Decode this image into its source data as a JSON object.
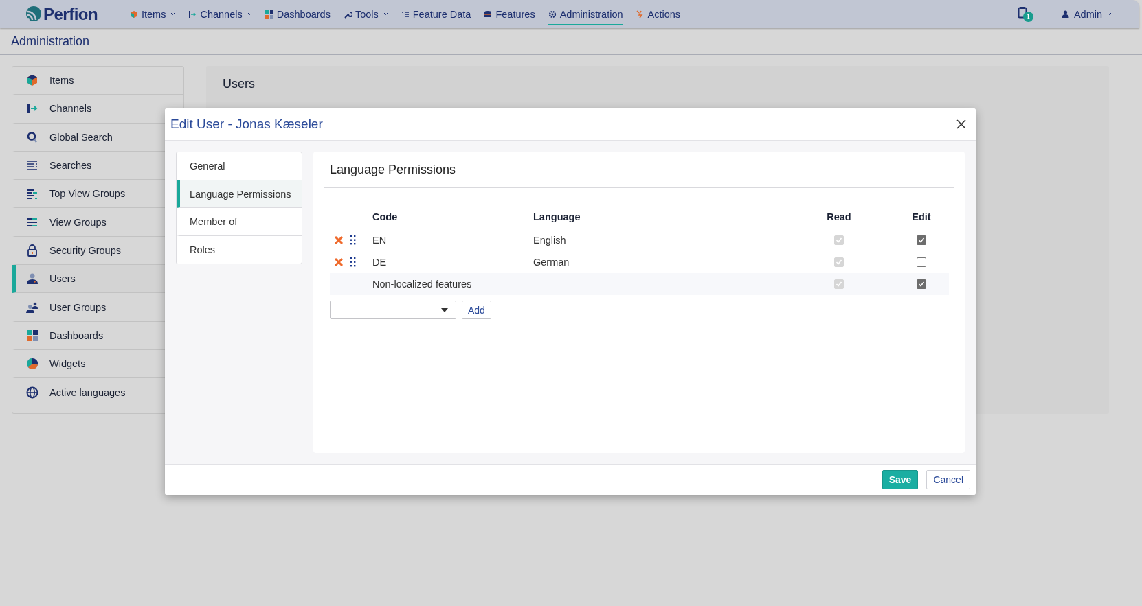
{
  "top_nav": {
    "logo": "Perfion",
    "items": [
      {
        "label": "Items",
        "has_menu": true,
        "selected": false
      },
      {
        "label": "Channels",
        "has_menu": true,
        "selected": false
      },
      {
        "label": "Dashboards",
        "has_menu": false,
        "selected": false
      },
      {
        "label": "Tools",
        "has_menu": true,
        "selected": false
      },
      {
        "label": "Feature Data",
        "has_menu": false,
        "selected": false
      },
      {
        "label": "Features",
        "has_menu": false,
        "selected": false
      },
      {
        "label": "Administration",
        "has_menu": false,
        "selected": true
      },
      {
        "label": "Actions",
        "has_menu": false,
        "selected": false
      }
    ],
    "notification_count": "1",
    "user": "Admin"
  },
  "page_title": "Administration",
  "sidebar": {
    "items": [
      {
        "label": "Items",
        "selected": false
      },
      {
        "label": "Channels",
        "selected": false
      },
      {
        "label": "Global Search",
        "selected": false
      },
      {
        "label": "Searches",
        "selected": false
      },
      {
        "label": "Top View Groups",
        "selected": false
      },
      {
        "label": "View Groups",
        "selected": false
      },
      {
        "label": "Security Groups",
        "selected": false
      },
      {
        "label": "Users",
        "selected": true
      },
      {
        "label": "User Groups",
        "selected": false
      },
      {
        "label": "Dashboards",
        "selected": false
      },
      {
        "label": "Widgets",
        "selected": false
      },
      {
        "label": "Active languages",
        "selected": false
      }
    ]
  },
  "panel": {
    "title": "Users"
  },
  "dialog": {
    "title": "Edit User - Jonas Kæseler",
    "tabs": [
      {
        "label": "General",
        "selected": false
      },
      {
        "label": "Language Permissions",
        "selected": true
      },
      {
        "label": "Member of",
        "selected": false
      },
      {
        "label": "Roles",
        "selected": false
      }
    ],
    "section_title": "Language Permissions",
    "columns": [
      "Code",
      "Language",
      "Read",
      "Edit"
    ],
    "rows": [
      {
        "kind": "language",
        "code": "EN",
        "language": "English",
        "read": true,
        "read_disabled": true,
        "edit": true
      },
      {
        "kind": "language",
        "code": "DE",
        "language": "German",
        "read": true,
        "read_disabled": true,
        "edit": false
      },
      {
        "kind": "nonlocalized",
        "code": "Non-localized features",
        "read": true,
        "read_disabled": true,
        "edit": true
      }
    ],
    "add_button": "Add",
    "buttons": [
      {
        "label": "Save",
        "kind": "primary"
      },
      {
        "label": "Cancel",
        "kind": "secondary"
      }
    ]
  }
}
